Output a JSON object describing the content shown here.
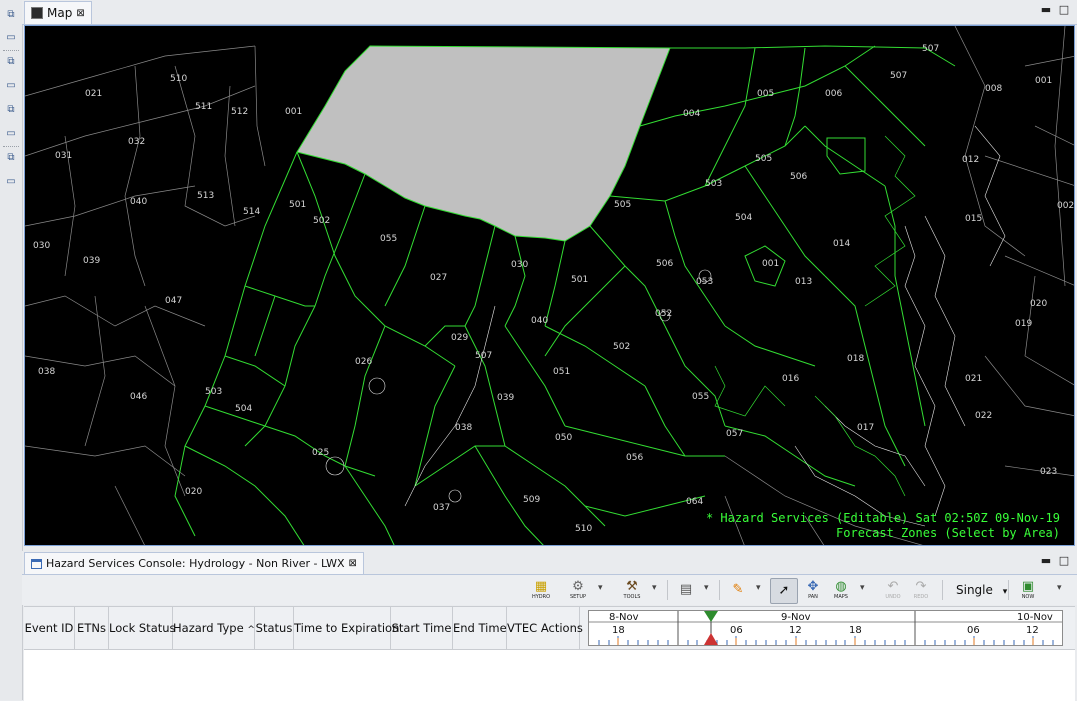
{
  "map_tab": {
    "label": "Map"
  },
  "map": {
    "status_line1": "* Hazard Services (Editable) Sat 02:50Z 09-Nov-19",
    "status_line2": "Forecast Zones (Select by Area)",
    "zone_labels": [
      "021",
      "510",
      "511",
      "512",
      "001",
      "032",
      "031",
      "040",
      "513",
      "514",
      "030",
      "039",
      "047",
      "038",
      "046",
      "020",
      "507",
      "004",
      "005",
      "006",
      "507",
      "505",
      "506",
      "503",
      "504",
      "001",
      "013",
      "014",
      "018",
      "016",
      "017",
      "012",
      "015",
      "020",
      "019",
      "021",
      "022",
      "023",
      "002",
      "008",
      "001",
      "501",
      "502",
      "055",
      "027",
      "030",
      "501",
      "040",
      "052",
      "053",
      "502",
      "051",
      "506",
      "505",
      "026",
      "029",
      "507",
      "039",
      "038",
      "050",
      "056",
      "504",
      "503",
      "025",
      "037",
      "509",
      "510",
      "064",
      "057",
      "055"
    ]
  },
  "console": {
    "title": "Hazard Services Console: Hydrology - Non River - LWX",
    "toolbar": {
      "hydro": "HYDRO",
      "setup": "SETUP",
      "tools": "TOOLS",
      "pan": "PAN",
      "maps": "MAPS",
      "undo": "UNDO",
      "redo": "REDO",
      "mode": "Single",
      "now": "NOW"
    },
    "columns": [
      "Event ID",
      "ETNs",
      "Lock Status",
      "Hazard Type",
      "Status",
      "Time to Expiration",
      "Start Time",
      "End Time",
      "VTEC Actions"
    ],
    "sort_indicator": "^",
    "timeline": {
      "days": [
        "8-Nov",
        "9-Nov",
        "10-Nov"
      ],
      "hours": [
        "18",
        "06",
        "12",
        "18",
        "06",
        "12"
      ]
    }
  }
}
